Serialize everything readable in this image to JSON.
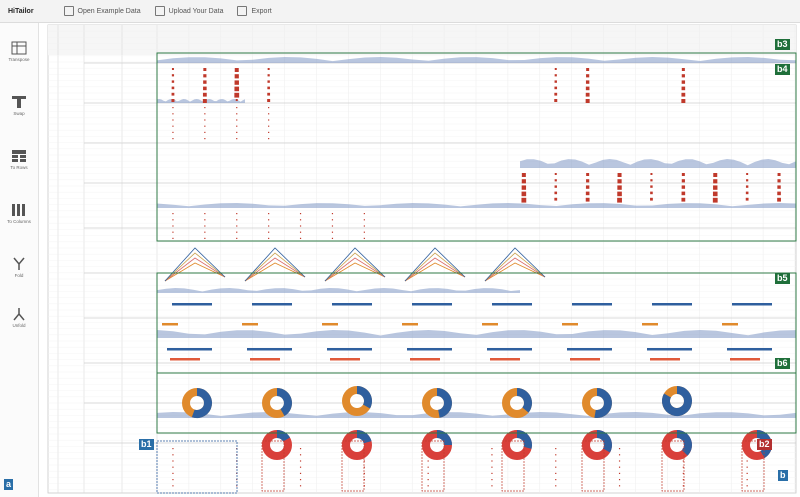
{
  "app": {
    "title": "HiTailor"
  },
  "toolbar": {
    "open_example": "Open Example Data",
    "upload": "Upload Your Data",
    "export": "Export"
  },
  "sidebar": {
    "items": [
      {
        "label": "Transpose",
        "icon": "transpose-icon"
      },
      {
        "label": "Swap",
        "icon": "swap-icon"
      },
      {
        "label": "To Rows",
        "icon": "to-rows-icon"
      },
      {
        "label": "To Columns",
        "icon": "to-columns-icon"
      },
      {
        "label": "Fold",
        "icon": "fold-icon"
      },
      {
        "label": "Unfold",
        "icon": "unfold-icon"
      }
    ]
  },
  "badges": {
    "a": "a",
    "b": "b",
    "b1": "b1",
    "b2": "b2",
    "b3": "b3",
    "b4": "b4",
    "b5": "b5",
    "b6": "b6"
  },
  "colors": {
    "green_badge": "#1f6f3a",
    "blue_badge": "#2a6fa8",
    "red_badge": "#b33030",
    "red_mark": "#c0392b",
    "blue_mark": "#2f5f9e",
    "orange_mark": "#e08a2c",
    "area_fill": "#7f97c4"
  }
}
